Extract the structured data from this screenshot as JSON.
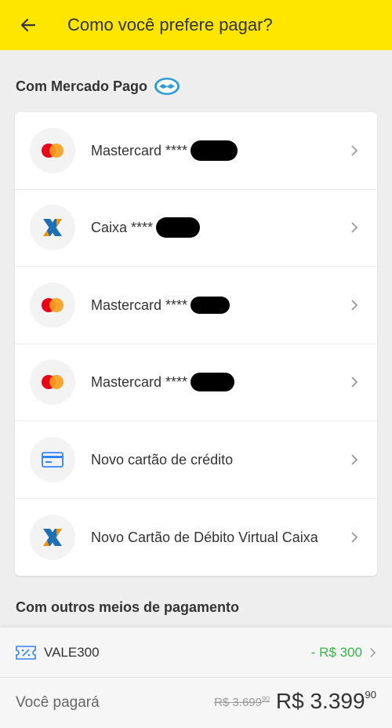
{
  "header": {
    "title": "Como você prefere pagar?",
    "back_icon": "arrow-left-icon"
  },
  "section_mp": {
    "title": "Com Mercado Pago",
    "logo": "mercado-pago-handshake-icon"
  },
  "payment_methods": [
    {
      "icon": "mastercard-icon",
      "label": "Mastercard ****"
    },
    {
      "icon": "caixa-icon",
      "label": "Caixa ****"
    },
    {
      "icon": "mastercard-icon",
      "label": "Mastercard ****"
    },
    {
      "icon": "mastercard-icon",
      "label": "Mastercard ****"
    },
    {
      "icon": "credit-card-icon",
      "label": "Novo cartão de crédito"
    },
    {
      "icon": "caixa-icon",
      "label": "Novo Cartão de Débito Virtual Caixa"
    }
  ],
  "section_other": {
    "title": "Com outros meios de pagamento"
  },
  "coupon": {
    "code": "VALE300",
    "discount": "- R$ 300",
    "icon": "ticket-icon"
  },
  "total": {
    "label": "Você pagará",
    "old_price": "R$ 3.699",
    "old_cents": "90",
    "new_price": "R$ 3.399",
    "new_cents": "90"
  },
  "colors": {
    "header": "#ffe600",
    "discount": "#39b54a",
    "mastercard_red": "#eb001b",
    "mastercard_orange": "#f79e1b",
    "caixa_blue": "#1f6fb5",
    "caixa_orange": "#f39200"
  }
}
